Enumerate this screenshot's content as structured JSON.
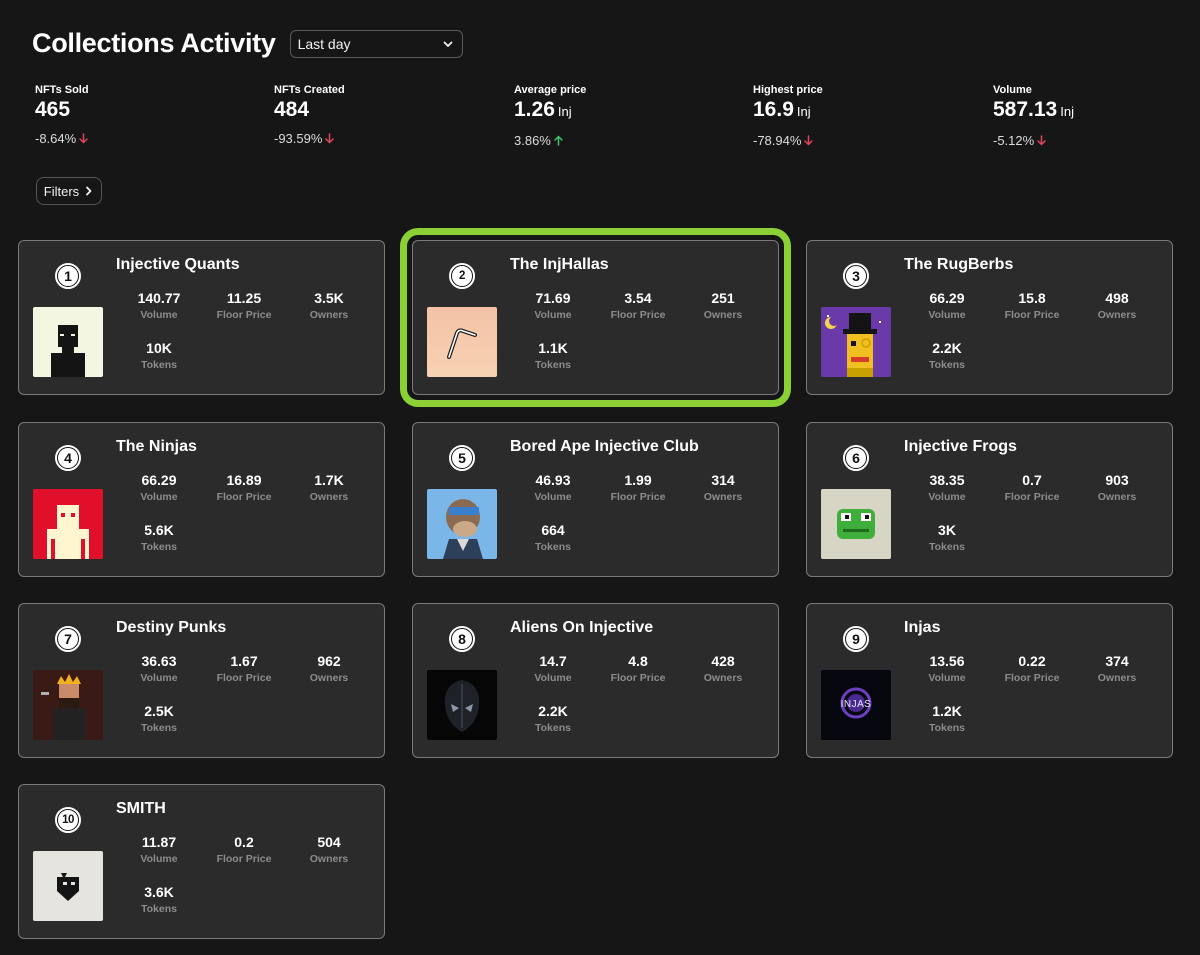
{
  "header": {
    "title": "Collections Activity",
    "period_select": "Last day"
  },
  "stats": [
    {
      "label": "NFTs Sold",
      "value": "465",
      "unit": "",
      "change": "-8.64%",
      "direction": "down"
    },
    {
      "label": "NFTs Created",
      "value": "484",
      "unit": "",
      "change": "-93.59%",
      "direction": "down"
    },
    {
      "label": "Average price",
      "value": "1.26",
      "unit": "Inj",
      "change": "3.86%",
      "direction": "up"
    },
    {
      "label": "Highest price",
      "value": "16.9",
      "unit": "Inj",
      "change": "-78.94%",
      "direction": "down"
    },
    {
      "label": "Volume",
      "value": "587.13",
      "unit": "Inj",
      "change": "-5.12%",
      "direction": "down"
    }
  ],
  "filters_label": "Filters",
  "metric_labels": {
    "volume": "Volume",
    "floor": "Floor Price",
    "owners": "Owners",
    "tokens": "Tokens"
  },
  "colors": {
    "up": "#3ec46d",
    "down": "#e0455a",
    "highlight": "#8bd136",
    "card_bg": "#2b2b2b",
    "page_bg": "#161616"
  },
  "collections": [
    {
      "rank": "1",
      "name": "Injective Quants",
      "volume": "140.77",
      "floor": "11.25",
      "owners": "3.5K",
      "tokens": "10K",
      "image": "quant-silhouette"
    },
    {
      "rank": "2",
      "name": "The InjHallas",
      "volume": "71.69",
      "floor": "3.54",
      "owners": "251",
      "tokens": "1.1K",
      "image": "boomerang",
      "highlighted": true
    },
    {
      "rank": "3",
      "name": "The RugBerbs",
      "volume": "66.29",
      "floor": "15.8",
      "owners": "498",
      "tokens": "2.2K",
      "image": "tophat-character"
    },
    {
      "rank": "4",
      "name": "The Ninjas",
      "volume": "66.29",
      "floor": "16.89",
      "owners": "1.7K",
      "tokens": "5.6K",
      "image": "ninja-pixel"
    },
    {
      "rank": "5",
      "name": "Bored Ape Injective Club",
      "volume": "46.93",
      "floor": "1.99",
      "owners": "314",
      "tokens": "664",
      "image": "ape"
    },
    {
      "rank": "6",
      "name": "Injective Frogs",
      "volume": "38.35",
      "floor": "0.7",
      "owners": "903",
      "tokens": "3K",
      "image": "frog"
    },
    {
      "rank": "7",
      "name": "Destiny Punks",
      "volume": "36.63",
      "floor": "1.67",
      "owners": "962",
      "tokens": "2.5K",
      "image": "crowned-punk"
    },
    {
      "rank": "8",
      "name": "Aliens On Injective",
      "volume": "14.7",
      "floor": "4.8",
      "owners": "428",
      "tokens": "2.2K",
      "image": "alien-mask"
    },
    {
      "rank": "9",
      "name": "Injas",
      "volume": "13.56",
      "floor": "0.22",
      "owners": "374",
      "tokens": "1.2K",
      "image": "injas-logo",
      "image_text": "INJAS"
    },
    {
      "rank": "10",
      "name": "SMITH",
      "volume": "11.87",
      "floor": "0.2",
      "owners": "504",
      "tokens": "3.6K",
      "image": "smith-logo"
    }
  ]
}
